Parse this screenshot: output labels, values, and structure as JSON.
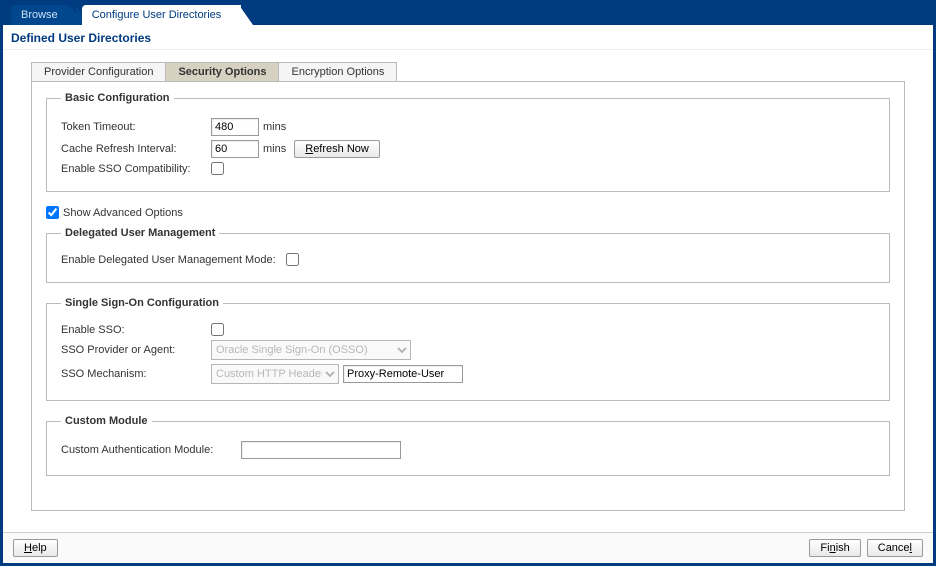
{
  "topTabs": {
    "browse": "Browse",
    "configure": "Configure User Directories"
  },
  "pageTitle": "Defined User Directories",
  "innerTabs": {
    "provider": "Provider Configuration",
    "security": "Security Options",
    "encryption": "Encryption Options"
  },
  "basic": {
    "legend": "Basic Configuration",
    "tokenTimeoutLabel": "Token Timeout:",
    "tokenTimeoutValue": "480",
    "tokenTimeoutUnit": "mins",
    "cacheRefreshLabel": "Cache Refresh Interval:",
    "cacheRefreshValue": "60",
    "cacheRefreshUnit": "mins",
    "refreshNow": "Refresh Now",
    "enableSSOCompatLabel": "Enable SSO Compatibility:"
  },
  "advanced": {
    "showLabel": "Show Advanced Options"
  },
  "delegated": {
    "legend": "Delegated User Management",
    "enableLabel": "Enable Delegated User Management Mode:"
  },
  "sso": {
    "legend": "Single Sign-On Configuration",
    "enableLabel": "Enable SSO:",
    "providerLabel": "SSO Provider or Agent:",
    "providerValue": "Oracle Single Sign-On (OSSO)",
    "mechLabel": "SSO Mechanism:",
    "mechValue": "Custom HTTP Header",
    "mechInputValue": "Proxy-Remote-User"
  },
  "custom": {
    "legend": "Custom Module",
    "label": "Custom Authentication Module:",
    "value": ""
  },
  "footer": {
    "help": "Help",
    "finish": "Finish",
    "cancel": "Cancel"
  }
}
